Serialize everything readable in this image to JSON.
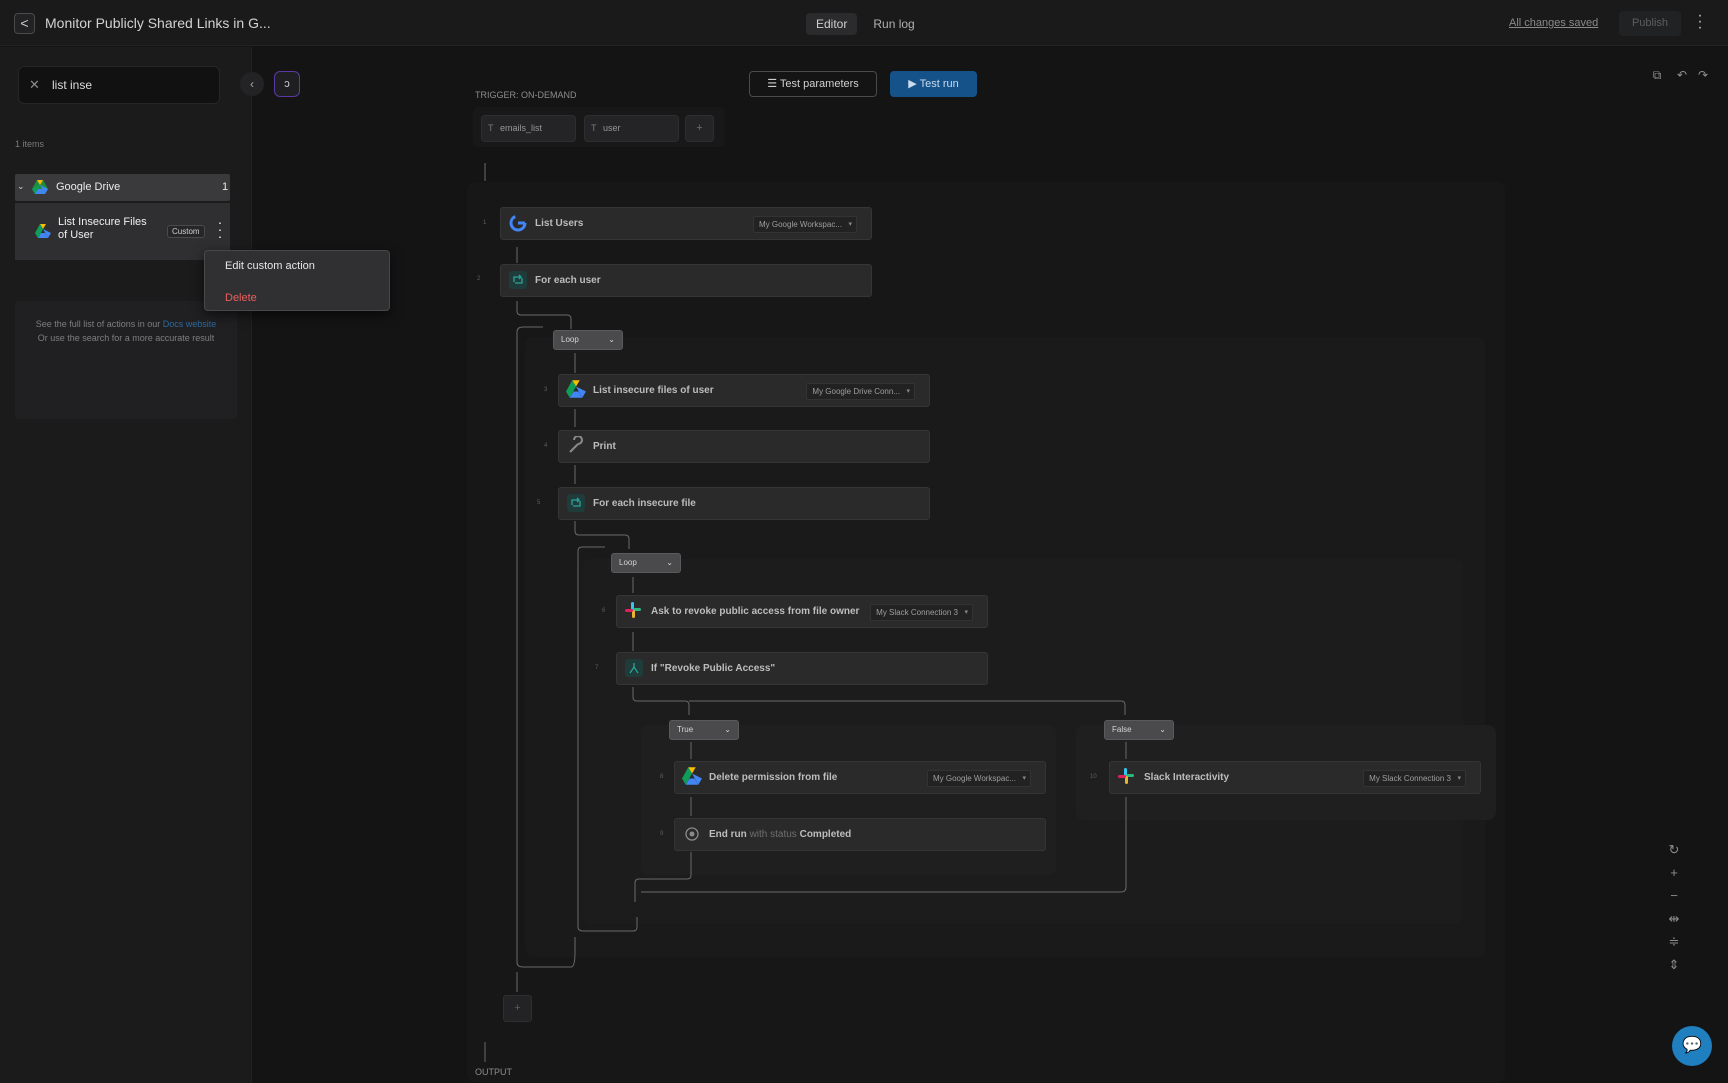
{
  "header": {
    "back_label": "<",
    "title": "Monitor Publicly Shared Links in G...",
    "tabs": [
      "Editor",
      "Run log"
    ],
    "saved_status": "All changes saved",
    "publish_label": "Publish"
  },
  "sidebar": {
    "search_value": "list inse",
    "results_count": "1 items",
    "group": {
      "name": "Google Drive",
      "count": "1"
    },
    "item": {
      "name": "List Insecure Files of User",
      "badge": "Custom"
    },
    "docs": {
      "pre": "See the full list of actions in our ",
      "link": "Docs website",
      "post": " Or use the search for a more accurate result"
    }
  },
  "context_menu": {
    "edit": "Edit custom action",
    "delete": "Delete"
  },
  "toolbar": {
    "test_params": "Test parameters",
    "test_run": "Test run"
  },
  "flow": {
    "trigger_label": "TRIGGER: ON-DEMAND",
    "params": [
      "emails_list",
      "user"
    ],
    "add_param": "+",
    "steps": {
      "s1": {
        "no": "1",
        "label": "List Users",
        "conn": "My Google Workspac..."
      },
      "s2": {
        "no": "2",
        "label": "For each user"
      },
      "loop1": "Loop",
      "s3": {
        "no": "3",
        "label": "List insecure files of user",
        "conn": "My Google Drive Conn..."
      },
      "s4": {
        "no": "4",
        "label": "Print"
      },
      "s5": {
        "no": "5",
        "label": "For each insecure file"
      },
      "loop2": "Loop",
      "s6": {
        "no": "6",
        "label": "Ask to revoke public access from file owner",
        "conn": "My Slack Connection 3"
      },
      "s7": {
        "no": "7",
        "label": "If \"Revoke Public Access\""
      },
      "true_tag": "True",
      "false_tag": "False",
      "s8": {
        "no": "8",
        "label": "Delete permission from file",
        "conn": "My Google Workspac..."
      },
      "s9": {
        "no": "9",
        "label_a": "End run",
        "label_b": "with status",
        "label_c": "Completed"
      },
      "s10": {
        "no": "10",
        "label": "Slack Interactivity",
        "conn": "My Slack Connection 3"
      }
    },
    "add_step": "+",
    "output_label": "OUTPUT"
  },
  "colors": {
    "accent": "#16528a",
    "danger": "#e8605e",
    "link": "#2c6aa0"
  }
}
